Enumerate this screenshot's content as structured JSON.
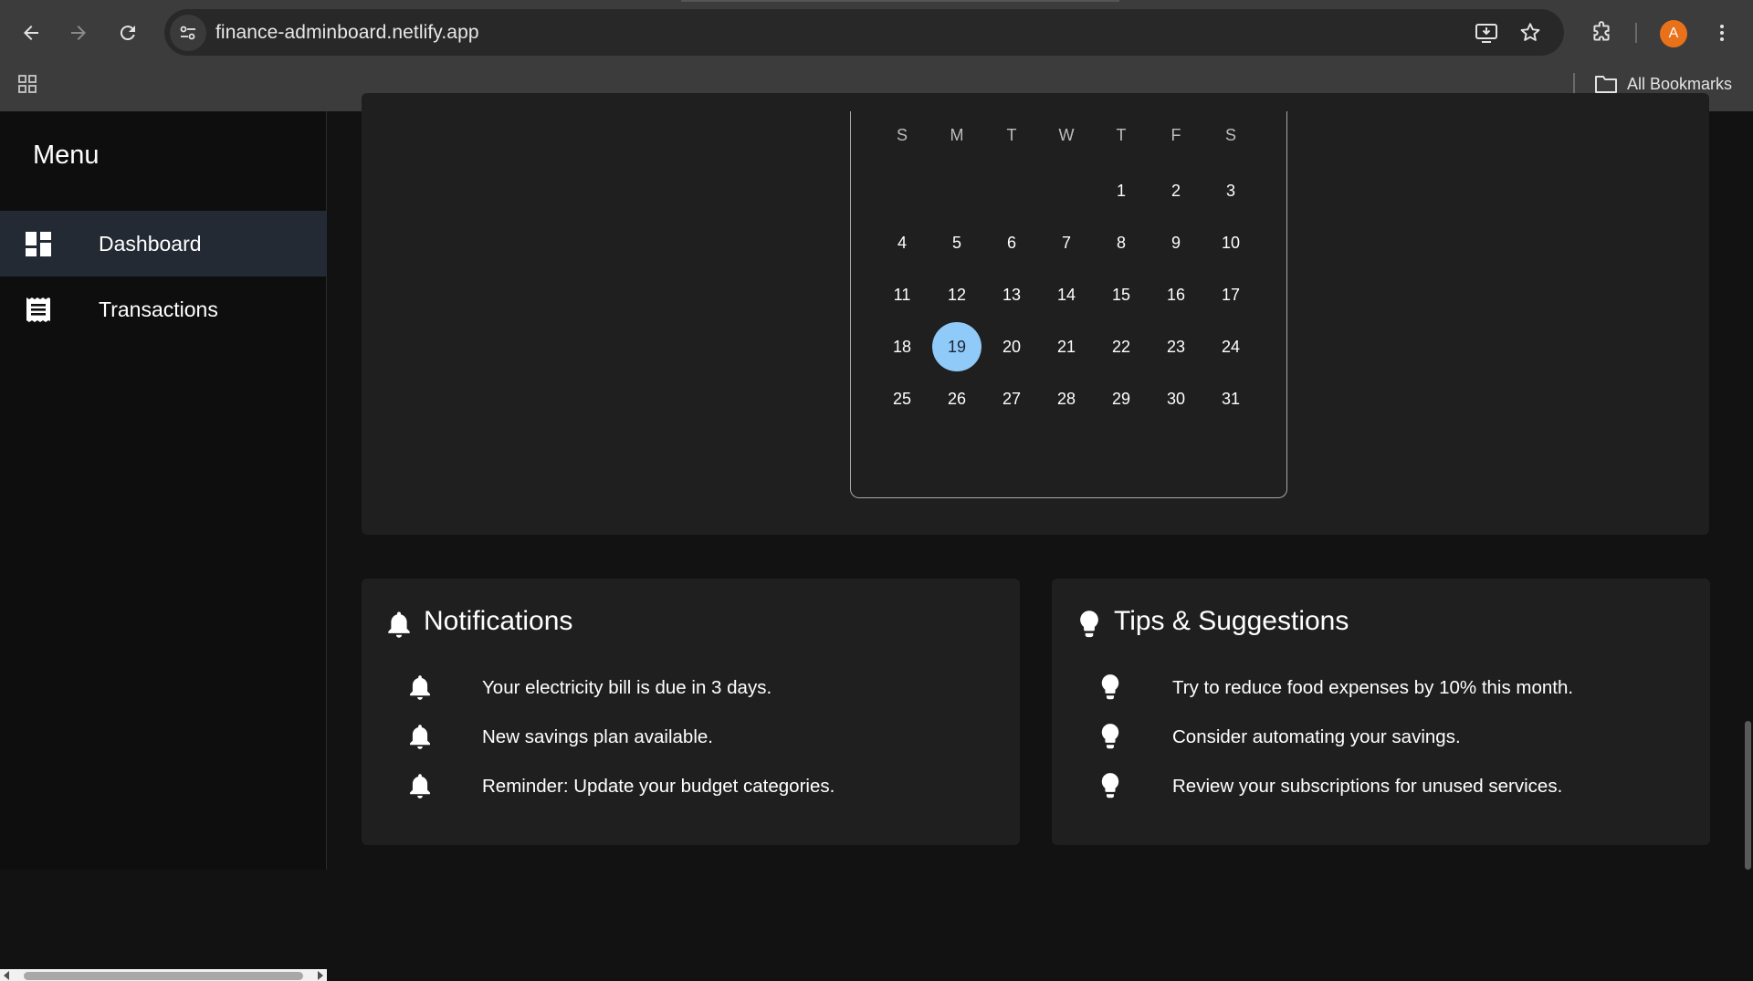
{
  "browser": {
    "url": "finance-adminboard.netlify.app",
    "avatar_letter": "A",
    "bookmarks_label": "All Bookmarks"
  },
  "sidebar": {
    "title": "Menu",
    "items": [
      {
        "label": "Dashboard",
        "icon": "dashboard-icon",
        "active": true
      },
      {
        "label": "Transactions",
        "icon": "receipt-icon",
        "active": false
      }
    ]
  },
  "calendar": {
    "weekdays": [
      "S",
      "M",
      "T",
      "W",
      "T",
      "F",
      "S"
    ],
    "first_weekday_index": 4,
    "days_in_month": 31,
    "selected_day": 19,
    "selected_color": "#90caf9"
  },
  "notifications": {
    "title": "Notifications",
    "icon": "bell-icon",
    "items": [
      "Your electricity bill is due in 3 days.",
      "New savings plan available.",
      "Reminder: Update your budget categories."
    ]
  },
  "tips": {
    "title": "Tips & Suggestions",
    "icon": "lightbulb-icon",
    "items": [
      "Try to reduce food expenses by 10% this month.",
      "Consider automating your savings.",
      "Review your subscriptions for unused services."
    ]
  }
}
